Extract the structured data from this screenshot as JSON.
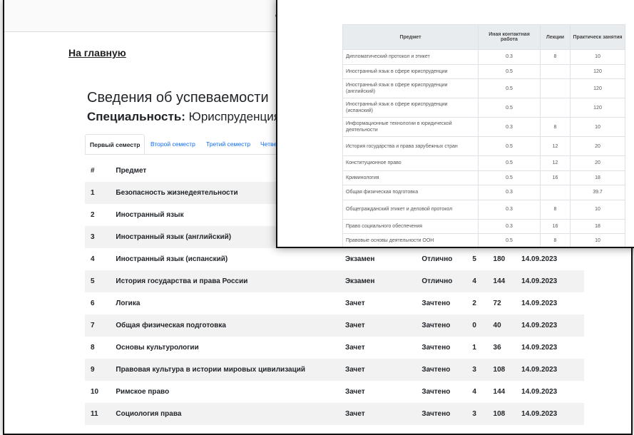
{
  "back": {
    "home_link": "На главную",
    "title": "Сведения об успеваемости",
    "specialty_label": "Специальность:",
    "specialty_value": "Юриспруденция",
    "tabs": [
      "Первый семестр",
      "Второй семестр",
      "Третий семестр",
      "Четвер"
    ],
    "table_headers": [
      "#",
      "Предмет"
    ],
    "rows": [
      {
        "n": "1",
        "subject": "Безопасность жизнедеятельности",
        "type": "",
        "grade": "",
        "credits": "",
        "hours": "",
        "date": ""
      },
      {
        "n": "2",
        "subject": "Иностранный язык",
        "type": "",
        "grade": "",
        "credits": "",
        "hours": "",
        "date": ""
      },
      {
        "n": "3",
        "subject": "Иностранный язык (английский)",
        "type": "",
        "grade": "",
        "credits": "",
        "hours": "",
        "date": ""
      },
      {
        "n": "4",
        "subject": "Иностранный язык (испанский)",
        "type": "Экзамен",
        "grade": "Отлично",
        "credits": "5",
        "hours": "180",
        "date": "14.09.2023"
      },
      {
        "n": "5",
        "subject": "История государства и права России",
        "type": "Экзамен",
        "grade": "Отлично",
        "credits": "4",
        "hours": "144",
        "date": "14.09.2023"
      },
      {
        "n": "6",
        "subject": "Логика",
        "type": "Зачет",
        "grade": "Зачтено",
        "credits": "2",
        "hours": "72",
        "date": "14.09.2023"
      },
      {
        "n": "7",
        "subject": "Общая физическая подготовка",
        "type": "Зачет",
        "grade": "Зачтено",
        "credits": "0",
        "hours": "40",
        "date": "14.09.2023"
      },
      {
        "n": "8",
        "subject": "Основы культурологии",
        "type": "Зачет",
        "grade": "Зачтено",
        "credits": "1",
        "hours": "36",
        "date": "14.09.2023"
      },
      {
        "n": "9",
        "subject": "Правовая культура в истории мировых цивилизаций",
        "type": "Зачет",
        "grade": "Зачтено",
        "credits": "3",
        "hours": "108",
        "date": "14.09.2023"
      },
      {
        "n": "10",
        "subject": "Римское право",
        "type": "Зачет",
        "grade": "Зачтено",
        "credits": "4",
        "hours": "144",
        "date": "14.09.2023"
      },
      {
        "n": "11",
        "subject": "Социология права",
        "type": "Зачет",
        "grade": "Зачтено",
        "credits": "3",
        "hours": "108",
        "date": "14.09.2023"
      }
    ]
  },
  "front": {
    "headers": [
      "Предмет",
      "Иная контактная работа",
      "Лекции",
      "Практическ занятия"
    ],
    "rows": [
      {
        "subject": "Дипломатический протокол и этикет",
        "other": "0.3",
        "lectures": "8",
        "practice": "10"
      },
      {
        "subject": "Иностранный язык в сфере юриспруденции",
        "other": "0.5",
        "lectures": "",
        "practice": "120"
      },
      {
        "subject": "Иностранный язык в сфере юриспруденции (английский)",
        "other": "0.5",
        "lectures": "",
        "practice": "120"
      },
      {
        "subject": "Иностранный язык в сфере юриспруденции (испанский)",
        "other": "0.5",
        "lectures": "",
        "practice": "120"
      },
      {
        "subject": "Информационные технологии в юридической деятельности",
        "other": "0.3",
        "lectures": "8",
        "practice": "10"
      },
      {
        "subject": "История государства и права зарубежных стран",
        "other": "0.5",
        "lectures": "12",
        "practice": "20"
      },
      {
        "subject": "Конституционное право",
        "other": "0.5",
        "lectures": "12",
        "practice": "20"
      },
      {
        "subject": "Криминология",
        "other": "0.5",
        "lectures": "16",
        "practice": "18"
      },
      {
        "subject": "Общая физическая подготовка",
        "other": "0.3",
        "lectures": "",
        "practice": "39.7"
      },
      {
        "subject": "Общегражданский этикет и деловой протокол",
        "other": "0.3",
        "lectures": "8",
        "practice": "10"
      },
      {
        "subject": "Право социального обеспечения",
        "other": "0.3",
        "lectures": "16",
        "practice": "18"
      },
      {
        "subject": "Правовые основы деятельности ООН",
        "other": "0.5",
        "lectures": "8",
        "practice": "10"
      }
    ]
  }
}
